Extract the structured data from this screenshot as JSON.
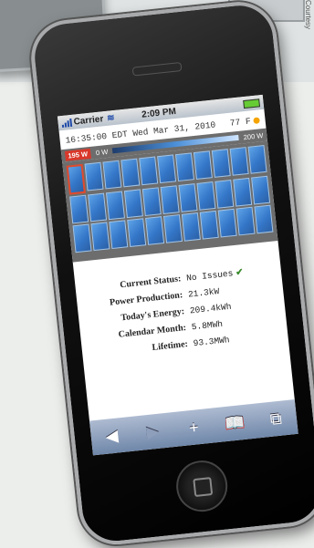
{
  "credit": "Courtesy",
  "status_bar": {
    "carrier": "Carrier",
    "time": "2:09 PM"
  },
  "header": {
    "timestamp": "16:35:00 EDT Wed Mar 31, 2010",
    "temperature": "77 F"
  },
  "scale": {
    "current_watts": "195 W",
    "min_label": "0 W",
    "max_label": "200 W"
  },
  "panels": {
    "columns": 11,
    "rows": 3,
    "selected_index": 0
  },
  "info": {
    "rows": [
      {
        "label": "Current Status:",
        "value": "No Issues"
      },
      {
        "label": "Power Production:",
        "value": "21.3kW"
      },
      {
        "label": "Today's Energy:",
        "value": "209.4kWh"
      },
      {
        "label": "Calendar Month:",
        "value": "5.8MWh"
      },
      {
        "label": "Lifetime:",
        "value": "93.3MWh"
      }
    ],
    "status_icon": "checkmark-icon"
  },
  "toolbar": {
    "back": "◀",
    "forward": "▶",
    "add": "+",
    "bookmarks": "📖",
    "pages": "⧉"
  },
  "colors": {
    "accent": "#1f4aa8",
    "alert": "#d9382a",
    "panel": "#3476c8"
  }
}
